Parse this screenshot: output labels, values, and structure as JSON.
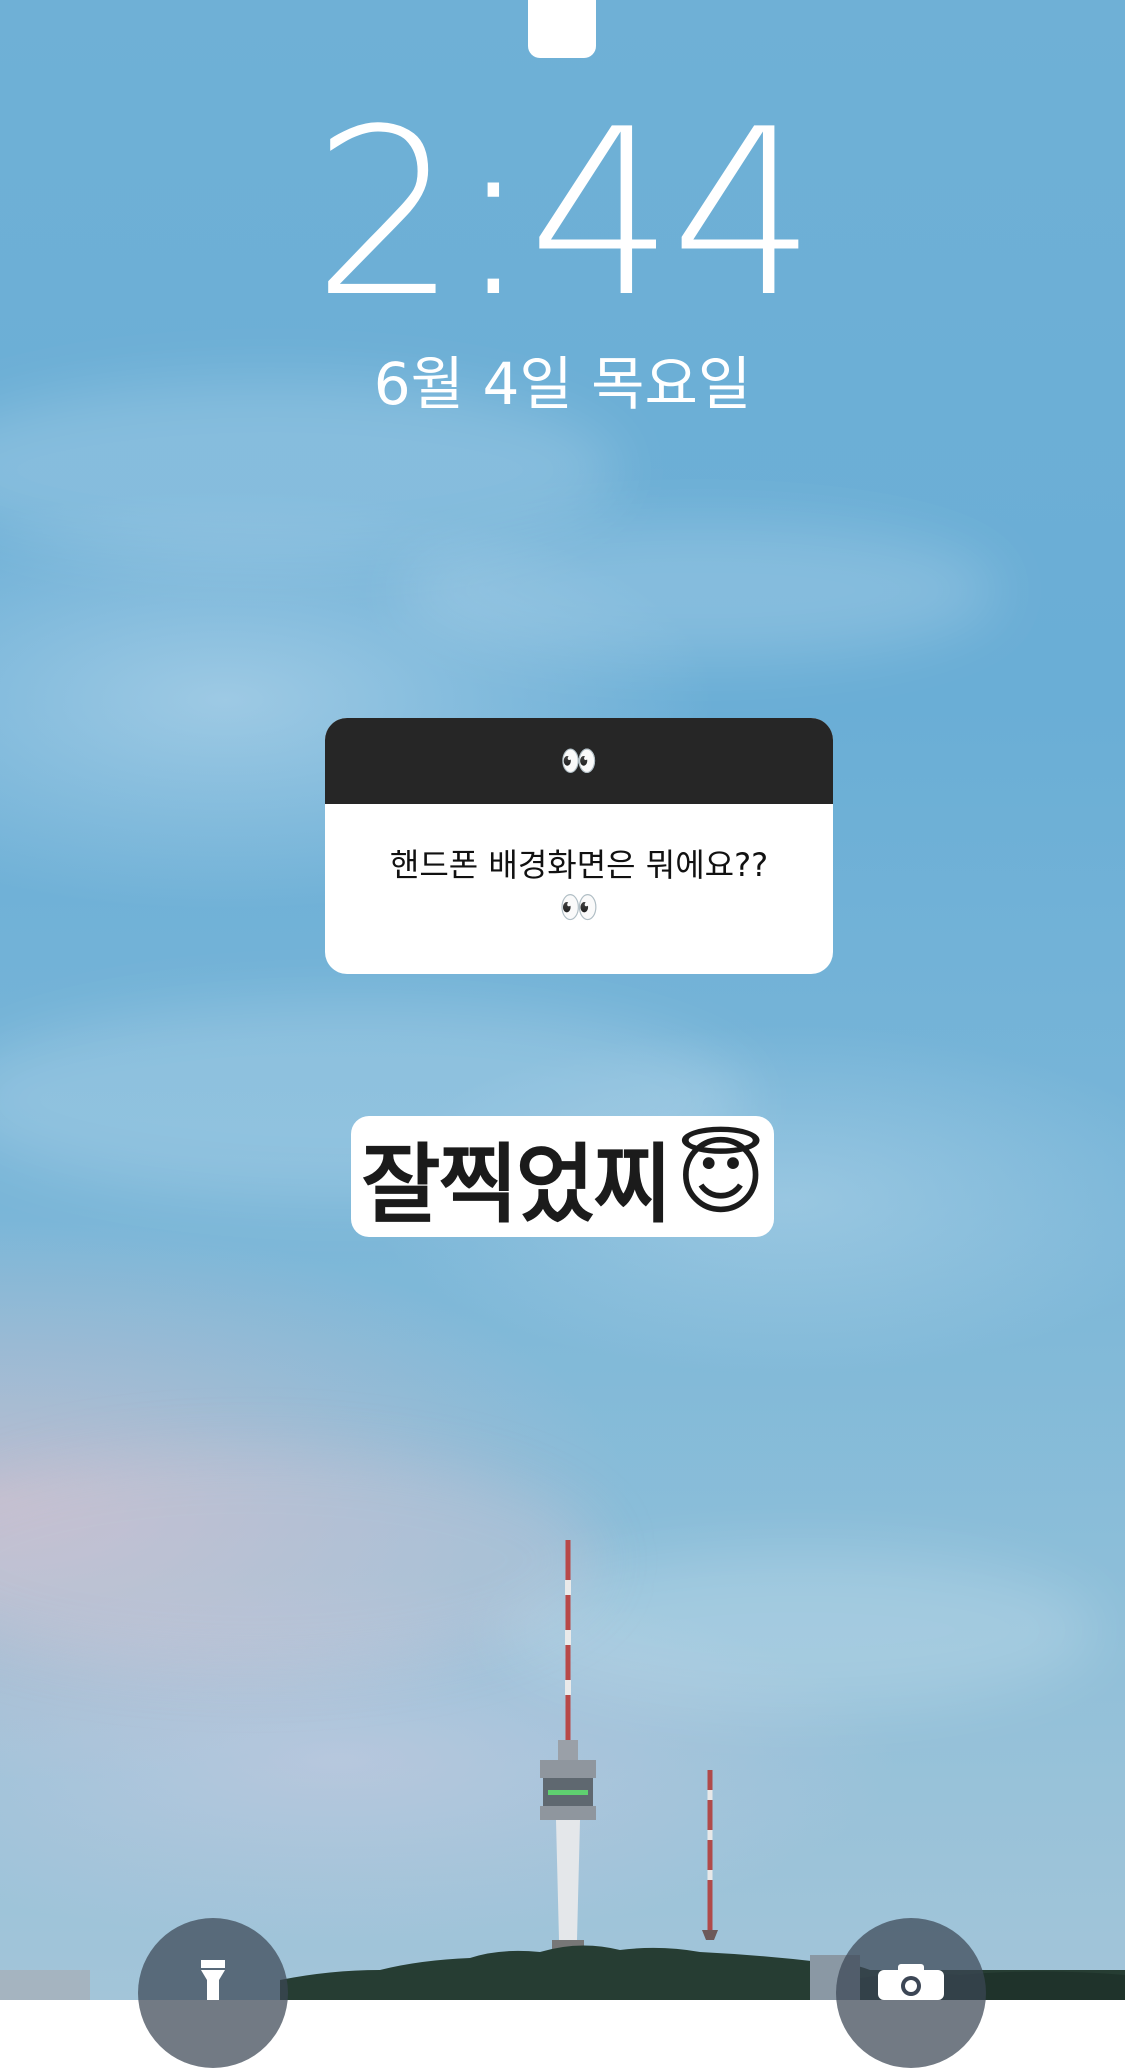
{
  "lock_screen": {
    "time": "2:44",
    "date": "6월 4일 목요일"
  },
  "question_sticker": {
    "header_emoji": "👀",
    "question_line1": "핸드폰 배경화면은 뭐에요??",
    "question_line2": "👀"
  },
  "answer_sticker": {
    "text": "잘찍었찌",
    "emoji": "😇"
  },
  "quick_actions": {
    "left_icon": "flashlight-icon",
    "right_icon": "camera-icon"
  },
  "colors": {
    "sky": "#6aaed6",
    "sticker_header": "#262626",
    "sticker_body": "#ffffff",
    "quick_action_bg": "#3c4655"
  }
}
